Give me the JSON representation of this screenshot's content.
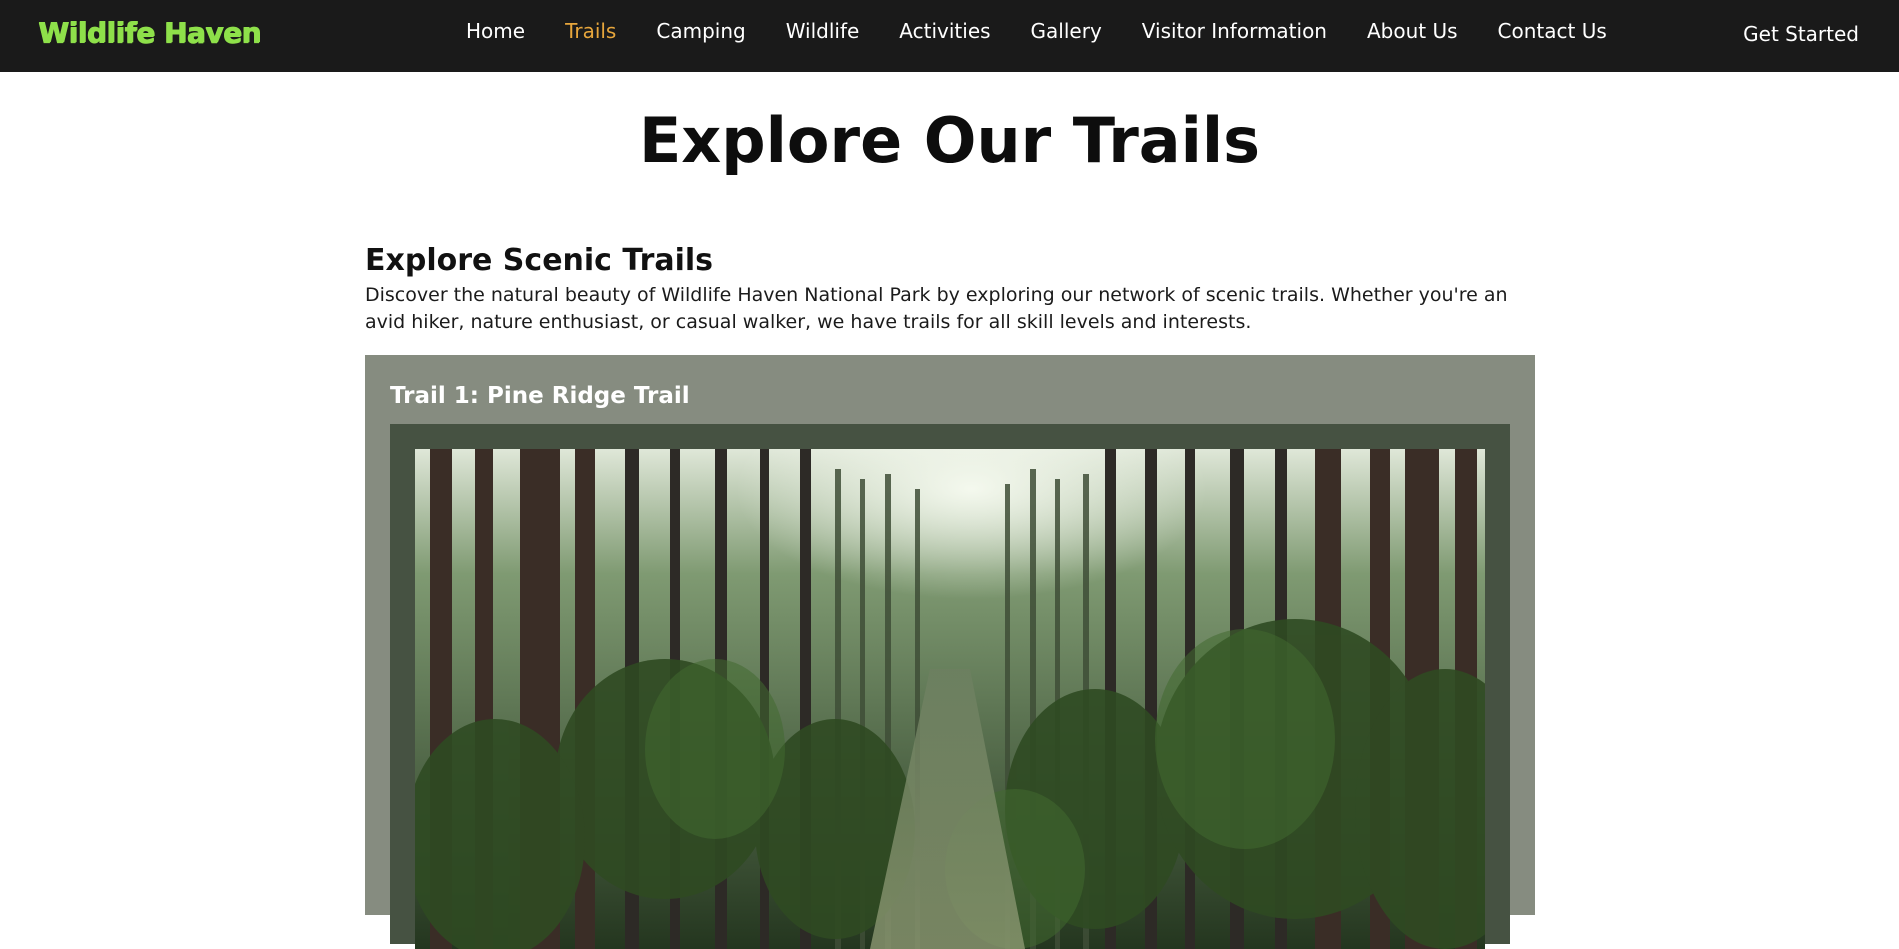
{
  "header": {
    "logo": "Wildlife Haven",
    "nav": [
      {
        "label": "Home",
        "active": false
      },
      {
        "label": "Trails",
        "active": true
      },
      {
        "label": "Camping",
        "active": false
      },
      {
        "label": "Wildlife",
        "active": false
      },
      {
        "label": "Activities",
        "active": false
      },
      {
        "label": "Gallery",
        "active": false
      },
      {
        "label": "Visitor Information",
        "active": false
      },
      {
        "label": "About Us",
        "active": false
      },
      {
        "label": "Contact Us",
        "active": false
      }
    ],
    "cta": "Get Started"
  },
  "page": {
    "title": "Explore Our Trails"
  },
  "section": {
    "heading": "Explore Scenic Trails",
    "text": "Discover the natural beauty of Wildlife Haven National Park by exploring our network of scenic trails. Whether you're an avid hiker, nature enthusiast, or casual walker, we have trails for all skill levels and interests."
  },
  "trails": [
    {
      "title": "Trail 1: Pine Ridge Trail"
    }
  ],
  "colors": {
    "header_bg": "#1a1a1a",
    "logo": "#8ee04a",
    "nav_active": "#e7a63c",
    "card_bg": "#868c80",
    "frame_bg": "#465242"
  }
}
